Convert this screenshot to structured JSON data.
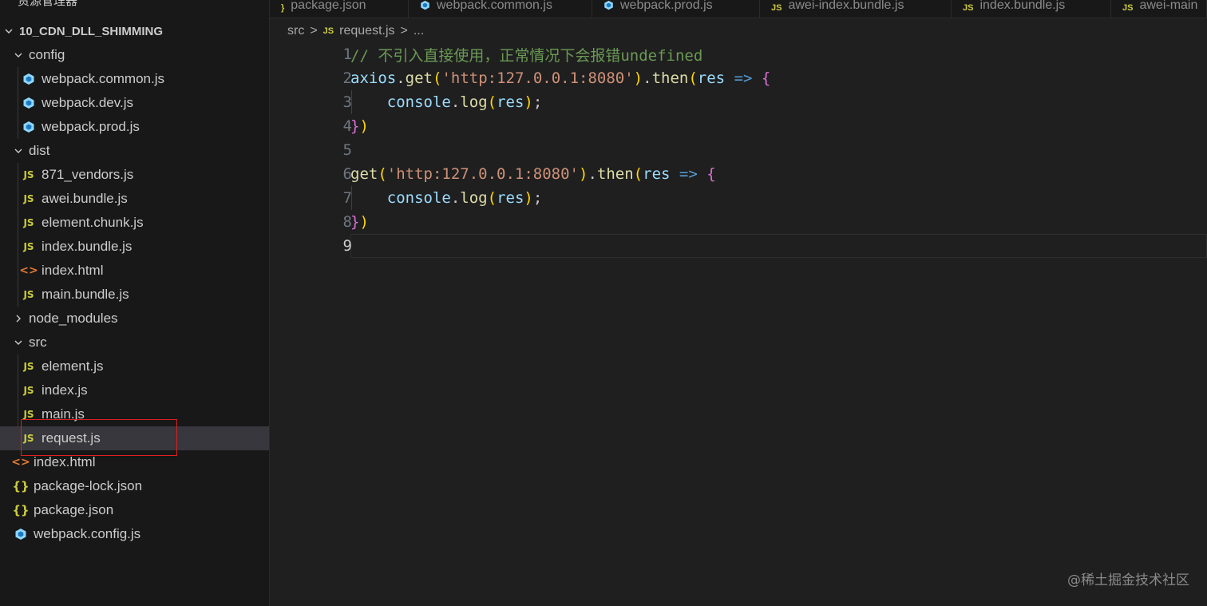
{
  "sidebar": {
    "title": "资源管理器",
    "more": "···",
    "project": "10_CDN_DLL_SHIMMING",
    "items": [
      {
        "label": "config",
        "kind": "folder",
        "open": true
      },
      {
        "label": "webpack.common.js",
        "kind": "webpack"
      },
      {
        "label": "webpack.dev.js",
        "kind": "webpack"
      },
      {
        "label": "webpack.prod.js",
        "kind": "webpack"
      },
      {
        "label": "dist",
        "kind": "folder",
        "open": true
      },
      {
        "label": "871_vendors.js",
        "kind": "js"
      },
      {
        "label": "awei.bundle.js",
        "kind": "js"
      },
      {
        "label": "element.chunk.js",
        "kind": "js"
      },
      {
        "label": "index.bundle.js",
        "kind": "js"
      },
      {
        "label": "index.html",
        "kind": "html"
      },
      {
        "label": "main.bundle.js",
        "kind": "js"
      },
      {
        "label": "node_modules",
        "kind": "folder",
        "open": false
      },
      {
        "label": "src",
        "kind": "folder",
        "open": true
      },
      {
        "label": "element.js",
        "kind": "js"
      },
      {
        "label": "index.js",
        "kind": "js"
      },
      {
        "label": "main.js",
        "kind": "js"
      },
      {
        "label": "request.js",
        "kind": "js",
        "selected": true
      },
      {
        "label": "index.html",
        "kind": "html"
      },
      {
        "label": "package-lock.json",
        "kind": "json"
      },
      {
        "label": "package.json",
        "kind": "json"
      },
      {
        "label": "webpack.config.js",
        "kind": "webpack"
      }
    ],
    "icons": {
      "js": "JS",
      "html": "<>",
      "json": "{}"
    }
  },
  "tabs": [
    {
      "label": "package.json",
      "kind": "json"
    },
    {
      "label": "webpack.common.js",
      "kind": "webpack"
    },
    {
      "label": "webpack.prod.js",
      "kind": "webpack"
    },
    {
      "label": "awei-index.bundle.js",
      "kind": "js"
    },
    {
      "label": "index.bundle.js",
      "kind": "js"
    },
    {
      "label": "awei-main",
      "kind": "js"
    }
  ],
  "breadcrumb": {
    "folder": "src",
    "file": "request.js",
    "sep": ">",
    "ellipsis": "...",
    "file_icon": "JS"
  },
  "editor": {
    "active_line": 9,
    "lines": [
      {
        "n": "1",
        "text": "// 不引入直接使用，正常情况下会报错undefined"
      },
      {
        "n": "2",
        "text": "axios.get('http:127.0.0.1:8080').then(res => {"
      },
      {
        "n": "3",
        "text": "    console.log(res);"
      },
      {
        "n": "4",
        "text": "})"
      },
      {
        "n": "5",
        "text": ""
      },
      {
        "n": "6",
        "text": "get('http:127.0.0.1:8080').then(res => {"
      },
      {
        "n": "7",
        "text": "    console.log(res);"
      },
      {
        "n": "8",
        "text": "})"
      },
      {
        "n": "9",
        "text": ""
      }
    ]
  },
  "watermark": "@稀土掘金技术社区",
  "colors": {
    "sidebar_bg": "#181818",
    "editor_bg": "#1f1f1f",
    "selection": "#37373d",
    "highlight": "#e02020",
    "js_icon": "#cbcb41",
    "html_icon": "#e37933"
  }
}
